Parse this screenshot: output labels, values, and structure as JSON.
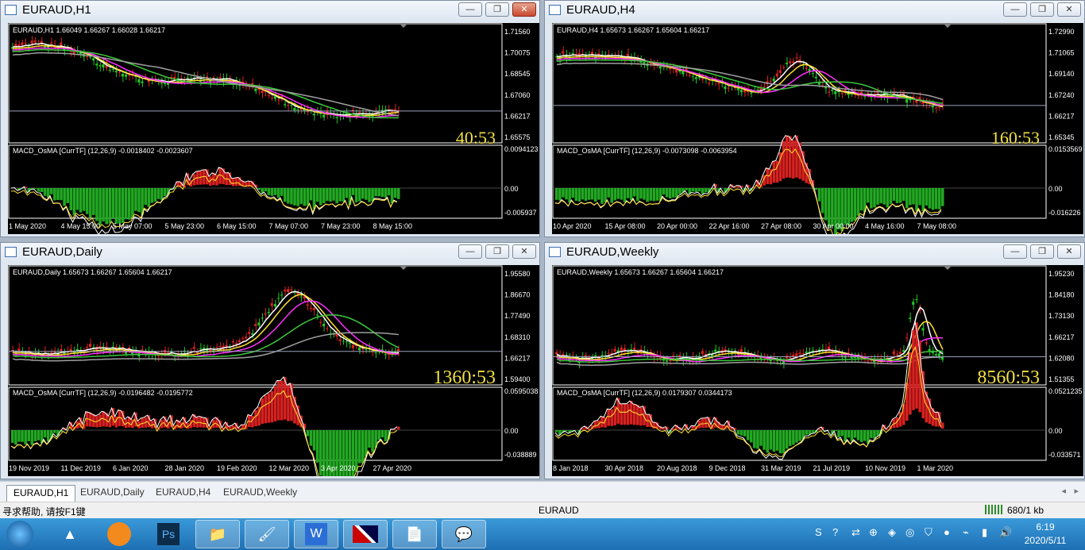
{
  "windows": [
    {
      "title": "EURAUD,H1",
      "info": "EURAUD,H1  1.66049 1.66267 1.66028 1.66217",
      "price_ticks": [
        "1.71560",
        "1.70075",
        "1.68545",
        "1.67060",
        "1.66217",
        "1.65575"
      ],
      "macd_label": "MACD_OsMA [CurrTF] (12,26,9) -0.0018402 -0.0023607",
      "macd_ticks": [
        "0.0094123",
        "0.00",
        "-0.005937"
      ],
      "countdown": "40:53",
      "dates": [
        "1 May 2020",
        "4 May 15:00",
        "5 May 07:00",
        "5 May 23:00",
        "6 May 15:00",
        "7 May 07:00",
        "7 May 23:00",
        "8 May 15:00"
      ]
    },
    {
      "title": "EURAUD,H4",
      "info": "EURAUD,H4  1.65673 1.66267 1.65604 1.66217",
      "price_ticks": [
        "1.72990",
        "1.71065",
        "1.69140",
        "1.67240",
        "1.66217",
        "1.65345"
      ],
      "macd_label": "MACD_OsMA [CurrTF] (12,26,9) -0.0073098 -0.0063954",
      "macd_ticks": [
        "0.0153569",
        "0.00",
        "-0.016226"
      ],
      "countdown": "160:53",
      "dates": [
        "10 Apr 2020",
        "15 Apr 08:00",
        "20 Apr 00:00",
        "22 Apr 16:00",
        "27 Apr 08:00",
        "30 Apr 00:00",
        "4 May 16:00",
        "7 May 08:00"
      ]
    },
    {
      "title": "EURAUD,Daily",
      "info": "EURAUD,Daily  1.65673 1.66267 1.65604 1.66217",
      "price_ticks": [
        "1.95580",
        "1.86670",
        "1.77490",
        "1.68310",
        "1.66217",
        "1.59400"
      ],
      "macd_label": "MACD_OsMA [CurrTF] (12,26,9) -0.0196482 -0.0195772",
      "macd_ticks": [
        "0.0595038",
        "0.00",
        "-0.038889"
      ],
      "countdown": "1360:53",
      "dates": [
        "19 Nov 2019",
        "11 Dec 2019",
        "6 Jan 2020",
        "28 Jan 2020",
        "19 Feb 2020",
        "12 Mar 2020",
        "3 Apr 2020",
        "27 Apr 2020"
      ]
    },
    {
      "title": "EURAUD,Weekly",
      "info": "EURAUD,Weekly  1.65673 1.66267 1.65604 1.66217",
      "price_ticks": [
        "1.95230",
        "1.84180",
        "1.73130",
        "1.66217",
        "1.62080",
        "1.51355"
      ],
      "macd_label": "MACD_OsMA [CurrTF] (12,26,9) 0.0179307 0.0344173",
      "macd_ticks": [
        "0.0521235",
        "0.00",
        "-0.033571"
      ],
      "countdown": "8560:53",
      "dates": [
        "8 Jan 2018",
        "30 Apr 2018",
        "20 Aug 2018",
        "9 Dec 2018",
        "31 Mar 2019",
        "21 Jul 2019",
        "10 Nov 2019",
        "1 Mar 2020"
      ]
    }
  ],
  "tabs": [
    "EURAUD,H1",
    "EURAUD,Daily",
    "EURAUD,H4",
    "EURAUD,Weekly"
  ],
  "status": {
    "help": "寻求帮助, 请按F1键",
    "symbol": "EURAUD",
    "traffic": "680/1 kb"
  },
  "clock": {
    "time": "6:19",
    "date": "2020/5/11"
  },
  "win_buttons": {
    "min": "—",
    "max": "❐",
    "close": "✕"
  }
}
